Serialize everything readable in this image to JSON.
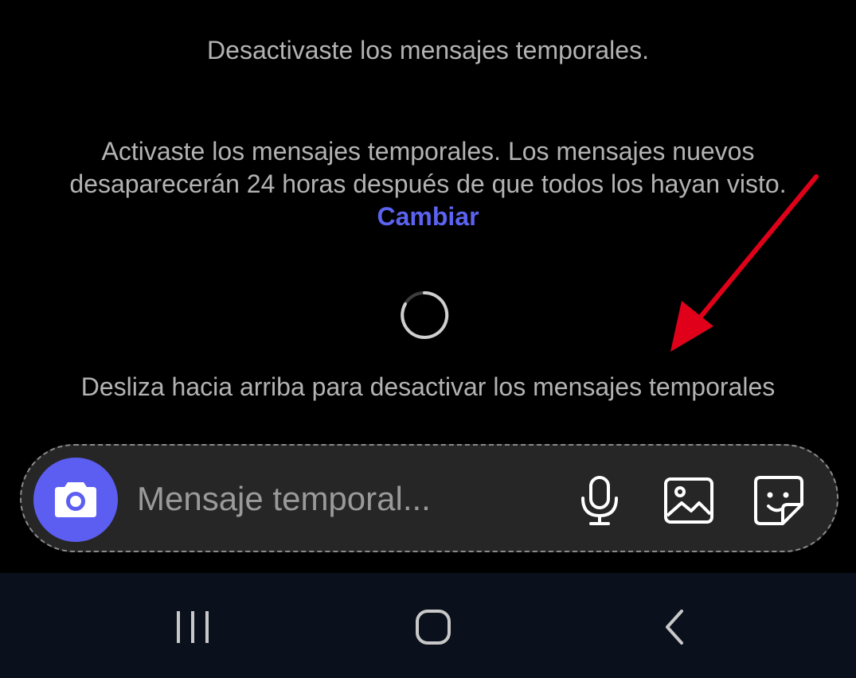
{
  "messages": {
    "disabled_notice": "Desactivaste los mensajes temporales.",
    "enabled_notice": "Activaste los mensajes temporales. Los mensajes nuevos desaparecerán 24 horas después de que todos los hayan visto.",
    "change_link": "Cambiar",
    "swipe_hint": "Desliza hacia arriba para desactivar los mensajes temporales"
  },
  "composer": {
    "placeholder": "Mensaje temporal...",
    "camera_icon": "camera-icon",
    "mic_icon": "microphone-icon",
    "gallery_icon": "image-icon",
    "sticker_icon": "sticker-icon"
  },
  "nav": {
    "recents_icon": "recents-icon",
    "home_icon": "home-icon",
    "back_icon": "back-icon"
  },
  "colors": {
    "background": "#000000",
    "accent": "#5b5ef0",
    "link": "#5b63f0",
    "annotation_arrow": "#e0001a",
    "nav_bar": "#0b111c"
  }
}
